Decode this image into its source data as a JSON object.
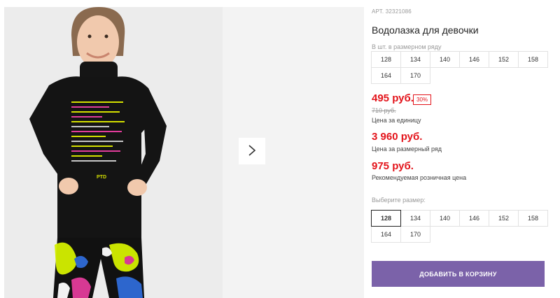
{
  "product": {
    "sku": "АРТ. 32321086",
    "title": "Водолазка для девочки",
    "size_range_caption": "В шт. в размерном ряду",
    "size_range": [
      "128",
      "134",
      "140",
      "146",
      "152",
      "158",
      "164",
      "170"
    ],
    "price": "495 руб.",
    "discount": "30%",
    "old_price": "710 руб.",
    "unit_price_label": "Цена за единицу",
    "range_price": "3 960 руб.",
    "range_price_label": "Цена за размерный ряд",
    "retail_price": "975 руб.",
    "retail_price_label": "Рекомендуемая розничная цена",
    "choose_size_caption": "Выберите размер:",
    "sizes": [
      "128",
      "134",
      "140",
      "146",
      "152",
      "158",
      "164",
      "170"
    ],
    "selected_size": "128",
    "add_to_cart": "ДОБАВИТЬ В КОРЗИНУ"
  },
  "gallery": {
    "next_icon": "chevron-right-icon",
    "print_text": "PTD"
  },
  "colors": {
    "accent_purple": "#7b62a9",
    "price_red": "#e3141b"
  }
}
